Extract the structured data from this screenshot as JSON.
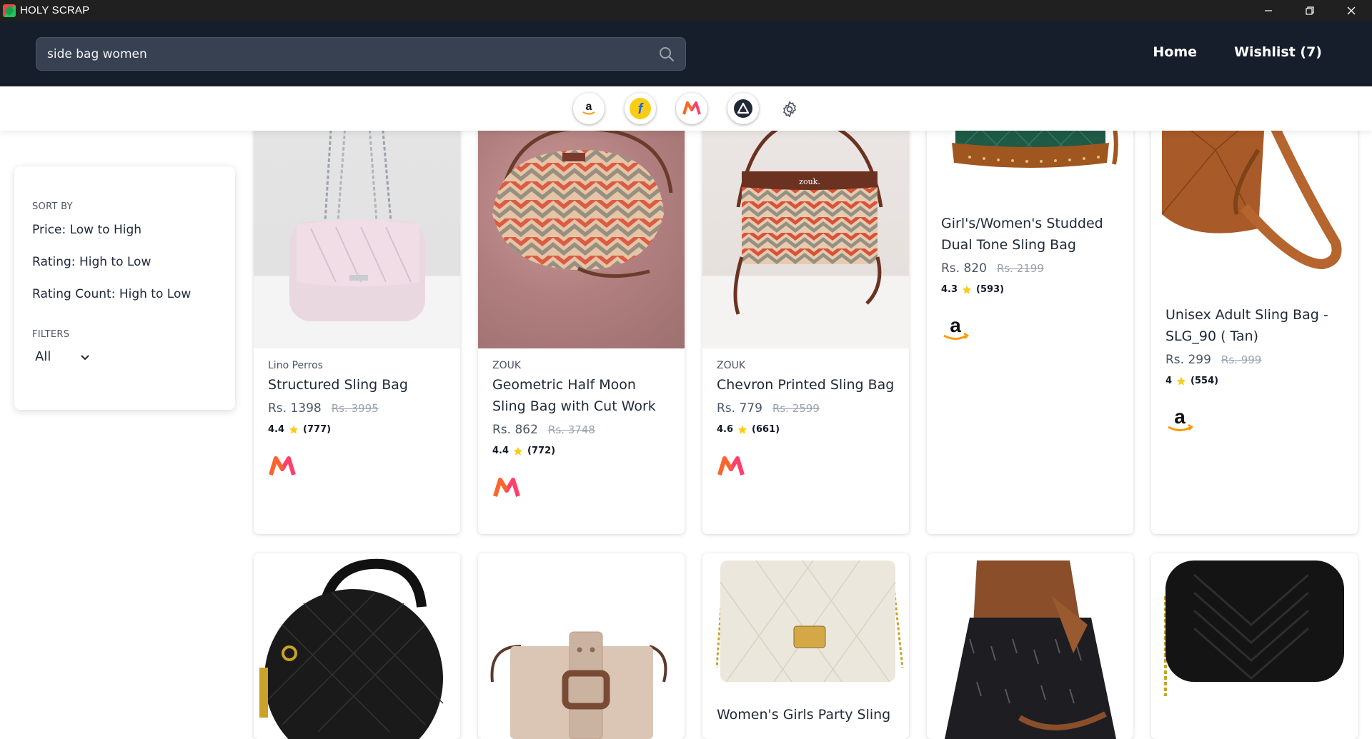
{
  "window": {
    "title": "HOLY SCRAP"
  },
  "header": {
    "search_value": "side bag women",
    "nav": {
      "home": "Home",
      "wishlist": "Wishlist (7)"
    }
  },
  "stores": [
    "amazon",
    "flipkart",
    "myntra",
    "ajio"
  ],
  "sidebar": {
    "sort_heading": "SORT BY",
    "sort_options": [
      "Price: Low to High",
      "Rating: High to Low",
      "Rating Count: High to Low"
    ],
    "filters_heading": "FILTERS",
    "filter_value": "All"
  },
  "products": [
    {
      "brand": "Lino Perros",
      "name": "Structured Sling Bag",
      "price": "Rs. 1398",
      "mrp": "Rs. 3995",
      "rating": "4.4",
      "count": "(777)",
      "store": "myntra-icon"
    },
    {
      "brand": "ZOUK",
      "name": "Geometric Half Moon Sling Bag with Cut Work",
      "price": "Rs. 862",
      "mrp": "Rs. 3748",
      "rating": "4.4",
      "count": "(772)",
      "store": "myntra-icon"
    },
    {
      "brand": "ZOUK",
      "name": "Chevron Printed Sling Bag",
      "price": "Rs. 779",
      "mrp": "Rs. 2599",
      "rating": "4.6",
      "count": "(661)",
      "store": "myntra-icon"
    },
    {
      "brand": "",
      "name": "Girl's/Women's Studded Dual Tone Sling Bag",
      "price": "Rs. 820",
      "mrp": "Rs. 2199",
      "rating": "4.3",
      "count": "(593)",
      "store": "amazon-icon"
    },
    {
      "brand": "",
      "name": "Unisex Adult Sling Bag - SLG_90 ( Tan)",
      "price": "Rs. 299",
      "mrp": "Rs. 999",
      "rating": "4",
      "count": "(554)",
      "store": "amazon-icon"
    },
    {
      "name": ""
    },
    {
      "name": ""
    },
    {
      "brand": "",
      "name": "Women's Girls Party Sling"
    },
    {
      "name": ""
    },
    {
      "name": ""
    }
  ],
  "colors": {
    "header_bg": "#161d2b",
    "search_bg": "#374151",
    "star": "#facc15",
    "myntra_pink": "#ff3f6c",
    "amazon_orange": "#ff9900"
  }
}
